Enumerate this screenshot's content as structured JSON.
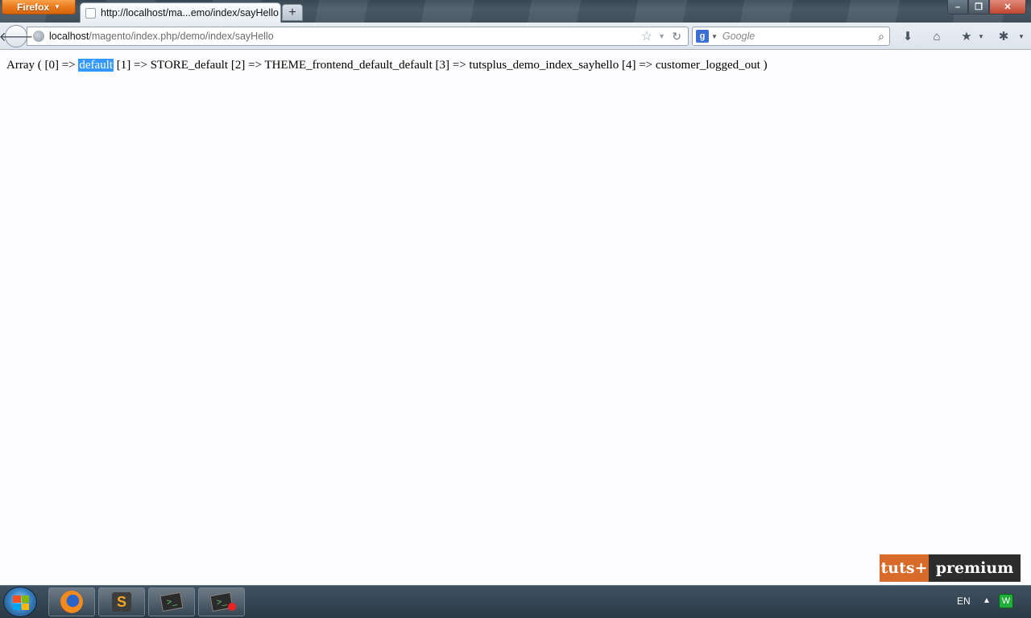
{
  "browser": {
    "menu_label": "Firefox",
    "tab_title": "http://localhost/ma...emo/index/sayHello",
    "new_tab_label": "+",
    "url_host": "localhost",
    "url_path": "/magento/index.php/demo/index/sayHello",
    "search_engine_icon": "g",
    "search_placeholder": "Google",
    "window_controls": {
      "minimize": "–",
      "maximize": "❐",
      "close": "✕"
    }
  },
  "toolbar_icons": [
    "back-arrow-icon",
    "globe-icon",
    "star-icon",
    "reload-icon",
    "download-icon",
    "home-icon",
    "bookmarks-icon",
    "addons-icon"
  ],
  "page": {
    "prefix": "Array ( [0] => ",
    "selected_word": "default",
    "suffix": " [1] => STORE_default [2] => THEME_frontend_default_default [3] => tutsplus_demo_index_sayhello [4] => customer_logged_out )"
  },
  "watermark": {
    "left": "tuts+",
    "right": "premium"
  },
  "taskbar": {
    "language": "EN",
    "tray_arrow": "▲",
    "tray_icon_letter": "W",
    "apps": [
      "firefox-icon",
      "sublime-text-icon",
      "terminal-icon",
      "terminal-recording-icon"
    ],
    "sublime_letter": "S",
    "terminal_glyph": ">_"
  },
  "colors": {
    "selection": "#3399ff",
    "tuts_orange": "#d86a2a",
    "firefox_orange": "#e8771a"
  }
}
